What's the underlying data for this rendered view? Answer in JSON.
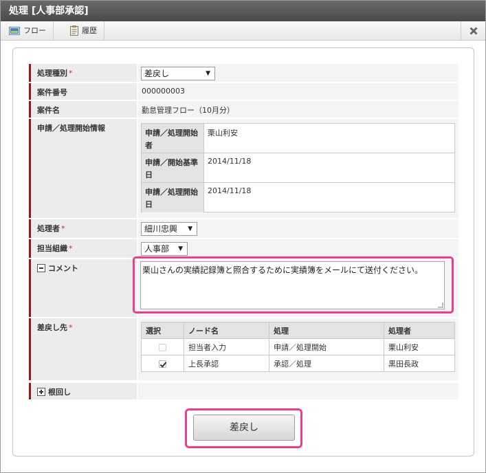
{
  "window": {
    "title": "処理 [人事部承認]"
  },
  "toolbar": {
    "flow_label": "フロー",
    "history_label": "履歴"
  },
  "form": {
    "type": {
      "label": "処理種別",
      "required": "*",
      "value": "差戻し"
    },
    "case_no": {
      "label": "案件番号",
      "value": "000000003"
    },
    "case_name": {
      "label": "案件名",
      "value": "勤怠管理フロー（10月分）"
    },
    "start_info": {
      "label": "申請／処理開始情報",
      "rows": [
        {
          "label": "申請／処理開始者",
          "value": "栗山利安"
        },
        {
          "label": "申請／開始基準日",
          "value": "2014/11/18"
        },
        {
          "label": "申請／処理開始日",
          "value": "2014/11/18"
        }
      ]
    },
    "processor": {
      "label": "処理者",
      "required": "*",
      "value": "細川忠興"
    },
    "org": {
      "label": "担当組織",
      "required": "*",
      "value": "人事部"
    },
    "comment": {
      "label": "コメント",
      "value": "栗山さんの実績記録簿と照合するために実績簿をメールにて送付ください。"
    },
    "return_to": {
      "label": "差戻し先",
      "required": "*",
      "headers": [
        "選択",
        "ノード名",
        "処理",
        "処理者"
      ],
      "rows": [
        {
          "node": "担当者入力",
          "action": "申請／処理開始",
          "person": "栗山利安"
        },
        {
          "node": "上長承認",
          "action": "承認／処理",
          "person": "黒田長政"
        }
      ]
    },
    "nemawashi": {
      "label": "根回し"
    }
  },
  "submit": {
    "label": "差戻し"
  },
  "colors": {
    "accent_bar": "#8b1a1a",
    "required": "#c8283a",
    "highlight": "#e8408a"
  }
}
